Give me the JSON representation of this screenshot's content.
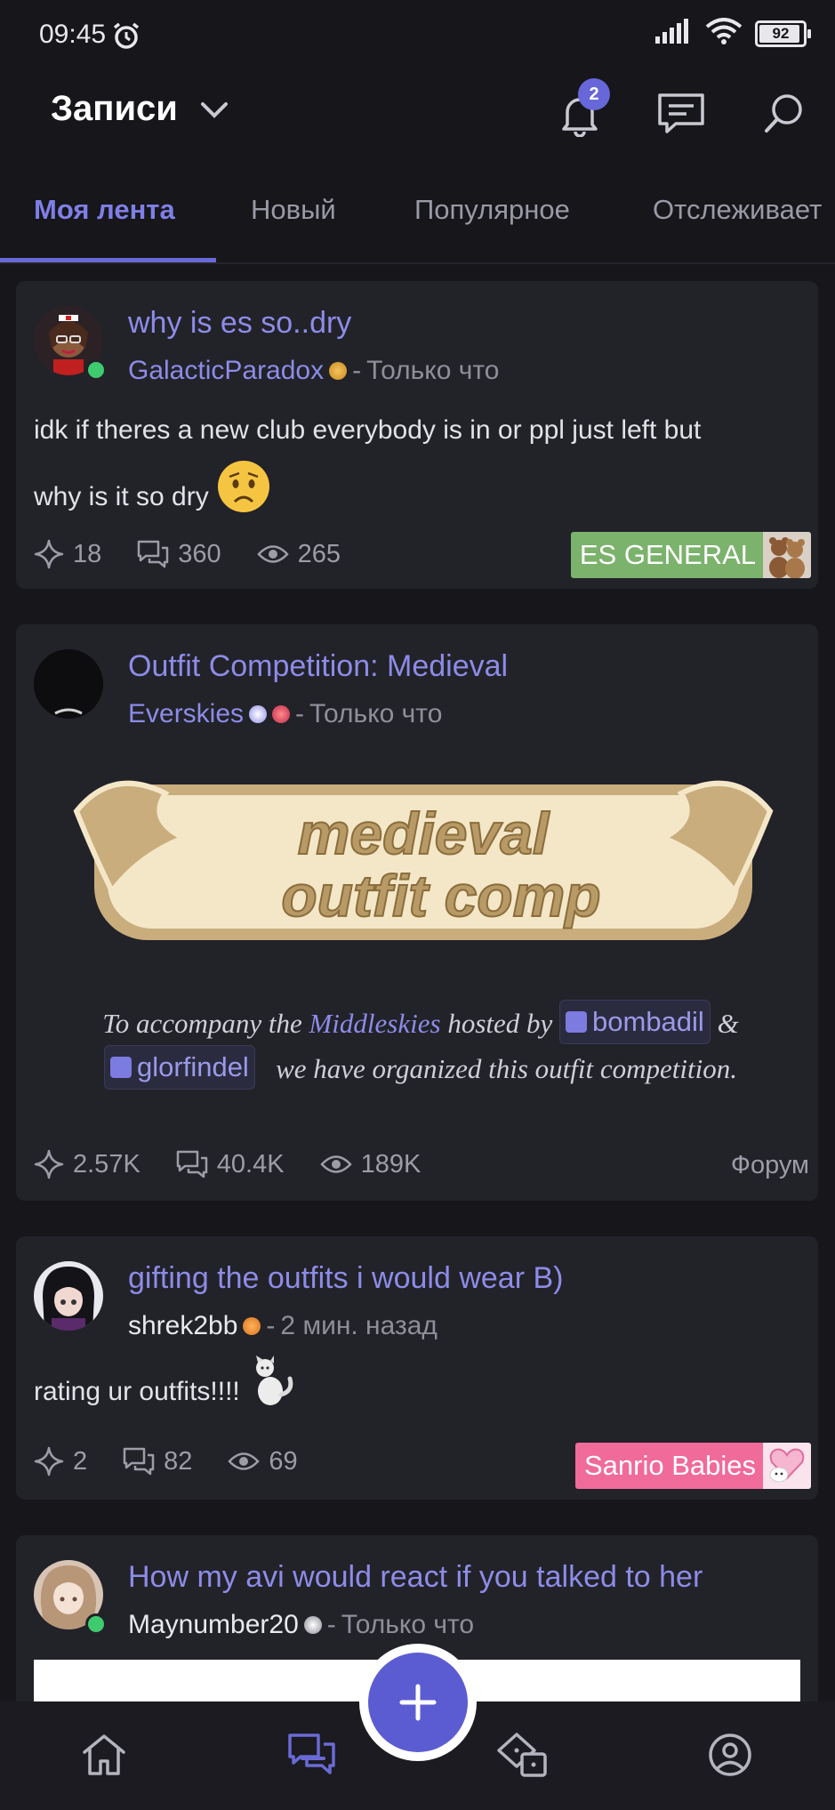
{
  "status_bar": {
    "time": "09:45",
    "battery": "92"
  },
  "header": {
    "title": "Записи",
    "notification_count": "2"
  },
  "tabs": [
    {
      "label": "Моя лента",
      "active": true
    },
    {
      "label": "Новый",
      "active": false
    },
    {
      "label": "Популярное",
      "active": false
    },
    {
      "label": "Отслеживает",
      "active": false
    }
  ],
  "posts": [
    {
      "title": "why is es so..dry",
      "author": "GalacticParadox",
      "sep": "-",
      "time": "Только что",
      "body_line1": "idk if theres a new club everybody is in or ppl just left but",
      "body_line2": "why is it so dry",
      "likes": "18",
      "comments": "360",
      "views": "265",
      "community": "ES GENERAL",
      "community_color": "#7bb26c"
    },
    {
      "title": "Outfit Competition: Medieval",
      "author": "Everskies",
      "sep": "-",
      "time": "Только что",
      "banner_line1": "medieval",
      "banner_line2": "outfit comp",
      "text_part1": "To accompany the ",
      "text_link": "Middleskies",
      "text_part2": " hosted by ",
      "mention1": "bombadil",
      "text_amp": " &",
      "mention2": "glorfindel",
      "text_part3": "we have organized this outfit competition.",
      "likes": "2.57K",
      "comments": "40.4K",
      "views": "189K",
      "forum": "Форум"
    },
    {
      "title": "gifting the outfits i would wear B)",
      "author": "shrek2bb",
      "sep": "-",
      "time": "2 мин. назад",
      "body": "rating ur outfits!!!!",
      "likes": "2",
      "comments": "82",
      "views": "69",
      "community": "Sanrio Babies",
      "community_color": "#f06a9a"
    },
    {
      "title": "How my avi would react if you talked to her",
      "author": "Maynumber20",
      "sep": "-",
      "time": "Только что"
    }
  ],
  "bottom_nav": [
    "home-icon",
    "posts-icon",
    "games-icon",
    "profile-icon"
  ],
  "colors": {
    "accent": "#6a6ad6",
    "background": "#16161b",
    "card": "#222229"
  }
}
